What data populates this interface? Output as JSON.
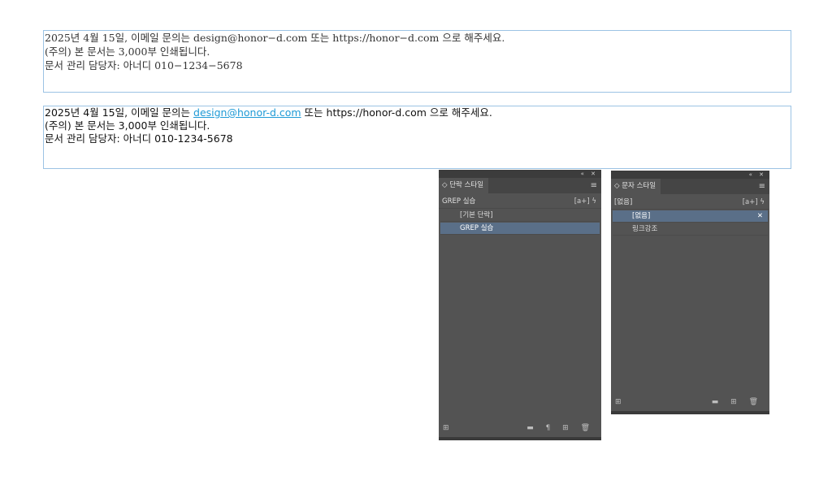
{
  "doc": {
    "frame1_lines": [
      "2025년 4월 15일, 이메일 문의는 design@honor−d.com 또는 https://honor−d.com 으로 해주세요.",
      "(주의) 본 문서는 3,000부 인쇄됩니다.",
      "문서 관리 담당자: 아너디 010−1234−5678"
    ],
    "frame2": {
      "line1_before": "2025년 4월 15일, 이메일 문의는 ",
      "line1_link": "design@honor-d.com",
      "line1_after": " 또는 https://honor-d.com 으로 해주세요.",
      "line2": "(주의) 본 문서는 3,000부 인쇄됩니다.",
      "line3": "문서 관리 담당자: 아너디 010-1234-5678"
    }
  },
  "paragraph_panel": {
    "tab_label": "◇ 단락 스타일",
    "collapse": "«  ✕",
    "menu_icon": "hamburger-icon",
    "current_style": "GREP 실습",
    "header_actions": "[a+]  ϟ",
    "styles": [
      "[기본 단락]",
      "GREP 실습"
    ],
    "selected_index": 1,
    "footer_left": "⊞",
    "footer_right": "▬ ¶ ⊞ 🗑"
  },
  "character_panel": {
    "tab_label": "◇ 문자 스타일",
    "collapse": "«  ✕",
    "menu_icon": "hamburger-icon",
    "current_style": "[없음]",
    "header_actions": "[a+]  ϟ",
    "styles": [
      "[없음]",
      "링크강조"
    ],
    "selected_index": 0,
    "selected_icon": "✕",
    "footer_left": "⊞",
    "footer_right": "▬ ⊞ 🗑"
  }
}
